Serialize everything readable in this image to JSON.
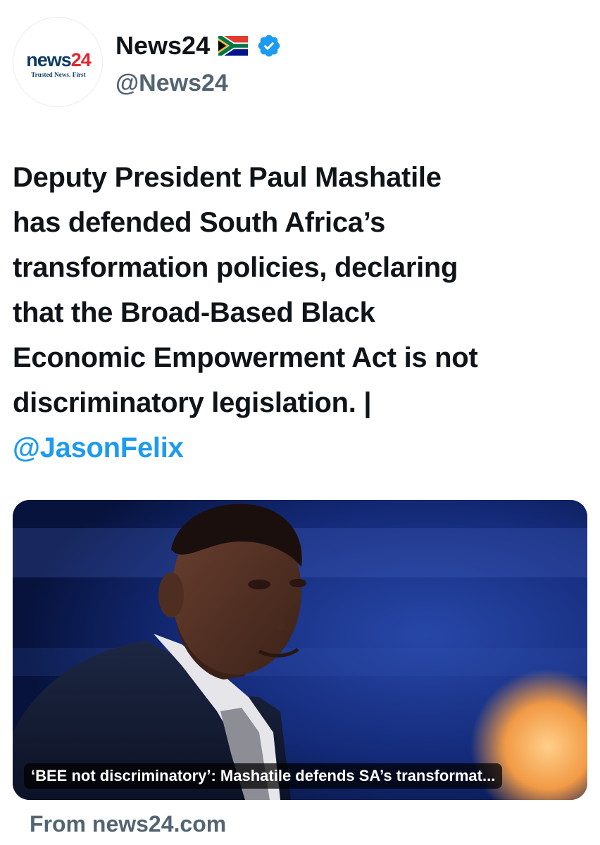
{
  "account": {
    "avatar_logo_part1": "news",
    "avatar_logo_part2": "24",
    "avatar_tagline": "Trusted News. First",
    "display_name": "News24",
    "flag_icon": "south-africa-flag-icon",
    "verified_icon": "verified-badge-icon",
    "handle": "@News24"
  },
  "tweet": {
    "lines": [
      "Deputy President Paul Mashatile",
      "has defended South Africa’s",
      "transformation policies, declaring",
      "that the Broad-Based Black",
      "Economic Empowerment Act is not",
      "discriminatory legislation. |"
    ],
    "mention": "@JasonFelix"
  },
  "link_card": {
    "caption": "‘BEE not discriminatory’: Mashatile defends SA’s transformat...",
    "source": "From news24.com"
  },
  "colors": {
    "text": "#0f1419",
    "secondary": "#536471",
    "link": "#1d9bf0",
    "verified": "#1d9bf0",
    "brand_navy": "#0d3b66",
    "brand_red": "#e3262f"
  }
}
